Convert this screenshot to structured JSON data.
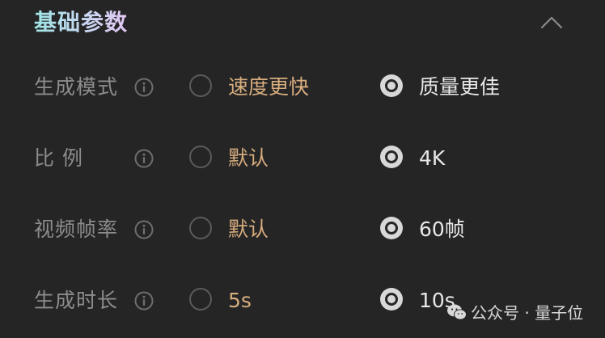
{
  "section": {
    "title": "基础参数",
    "collapse_icon": "chevron-up-icon"
  },
  "params": {
    "mode": {
      "label": "生成模式",
      "info_icon": "info-icon",
      "option_a": "速度更快",
      "option_b": "质量更佳",
      "selected": "质量更佳"
    },
    "ratio": {
      "label": "比 例",
      "info_icon": "info-icon",
      "option_a": "默认",
      "option_b": "4K",
      "selected": "4K"
    },
    "fps": {
      "label": "视频帧率",
      "info_icon": "info-icon",
      "option_a": "默认",
      "option_b": "60帧",
      "selected": "60帧"
    },
    "duration": {
      "label": "生成时长",
      "info_icon": "info-icon",
      "option_a": "5s",
      "option_b": "10s",
      "selected": "10s"
    }
  },
  "watermark": {
    "text": "公众号 · 量子位",
    "icon": "wechat-icon"
  },
  "colors": {
    "background": "#252526",
    "label": "#8c8c8c",
    "unselected_option": "#d8ad7e",
    "selected_option": "#e8e8e8"
  }
}
